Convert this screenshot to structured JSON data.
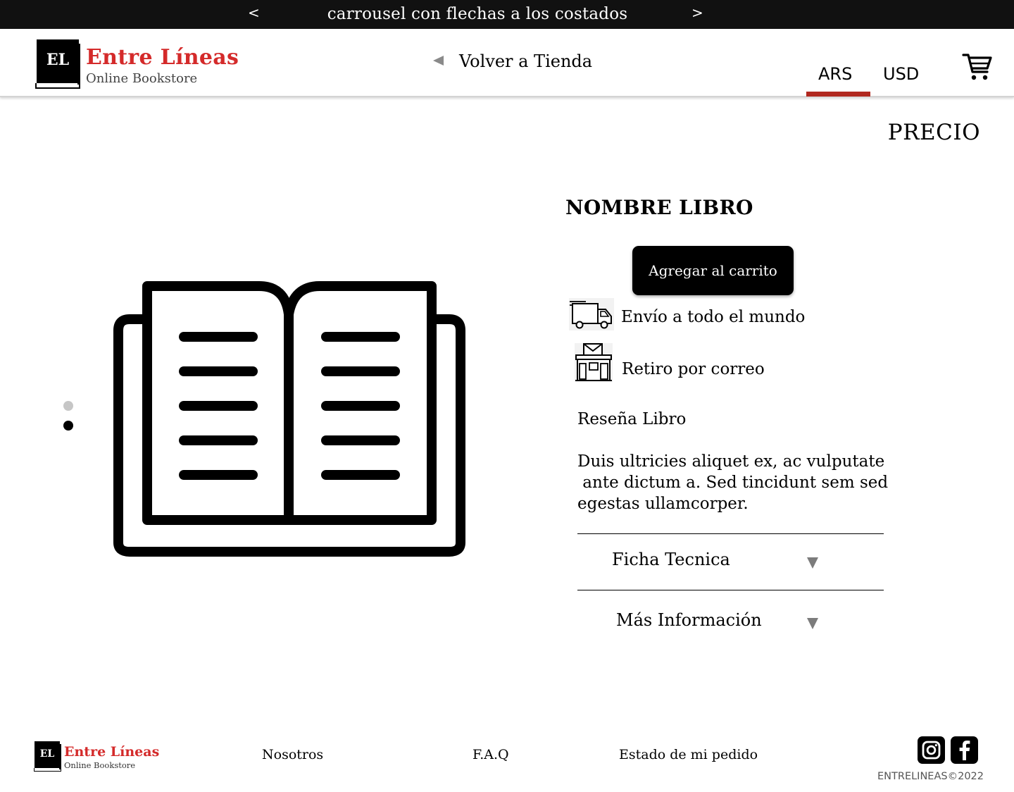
{
  "carousel": {
    "prev_label": "<",
    "next_label": ">",
    "text": "carrousel con flechas a los costados"
  },
  "header": {
    "logo": {
      "mark": "EL",
      "title": "Entre Líneas",
      "subtitle": "Online Bookstore"
    },
    "back_label": "Volver a Tienda",
    "currencies": [
      "ARS",
      "USD"
    ],
    "selected_currency": "ARS",
    "cart_icon": "shopping-cart-icon"
  },
  "product": {
    "price_label": "PRECIO",
    "name": "NOMBRE LIBRO",
    "add_to_cart_label": "Agregar al carrito",
    "image_icon": "open-book-icon",
    "image_slides": 2,
    "active_slide": 2,
    "features": [
      {
        "icon": "delivery-truck-icon",
        "label": "Envío a todo el mundo"
      },
      {
        "icon": "post-office-icon",
        "label": "Retiro por correo"
      }
    ],
    "review_title": "Reseña Libro",
    "review_lines": [
      "Duis ultricies aliquet ex, ac vulputate",
      " ante dictum a. Sed tincidunt sem sed",
      "egestas ullamcorper."
    ],
    "accordions": [
      {
        "label": "Ficha Tecnica",
        "icon": "dropdown-arrow-icon"
      },
      {
        "label": "Más Información",
        "icon": "dropdown-arrow-icon"
      }
    ]
  },
  "footer": {
    "logo": {
      "mark": "EL",
      "title": "Entre Líneas",
      "subtitle": "Online Bookstore"
    },
    "links": [
      "Nosotros",
      "F.A.Q",
      "Estado de mi pedido"
    ],
    "social": [
      "instagram-icon",
      "facebook-icon"
    ],
    "copyright": "ENTRELINEAS©2022"
  },
  "colors": {
    "brand_red": "#d42a2a",
    "underline_red": "#b1281f",
    "topbar_bg": "#111111"
  }
}
